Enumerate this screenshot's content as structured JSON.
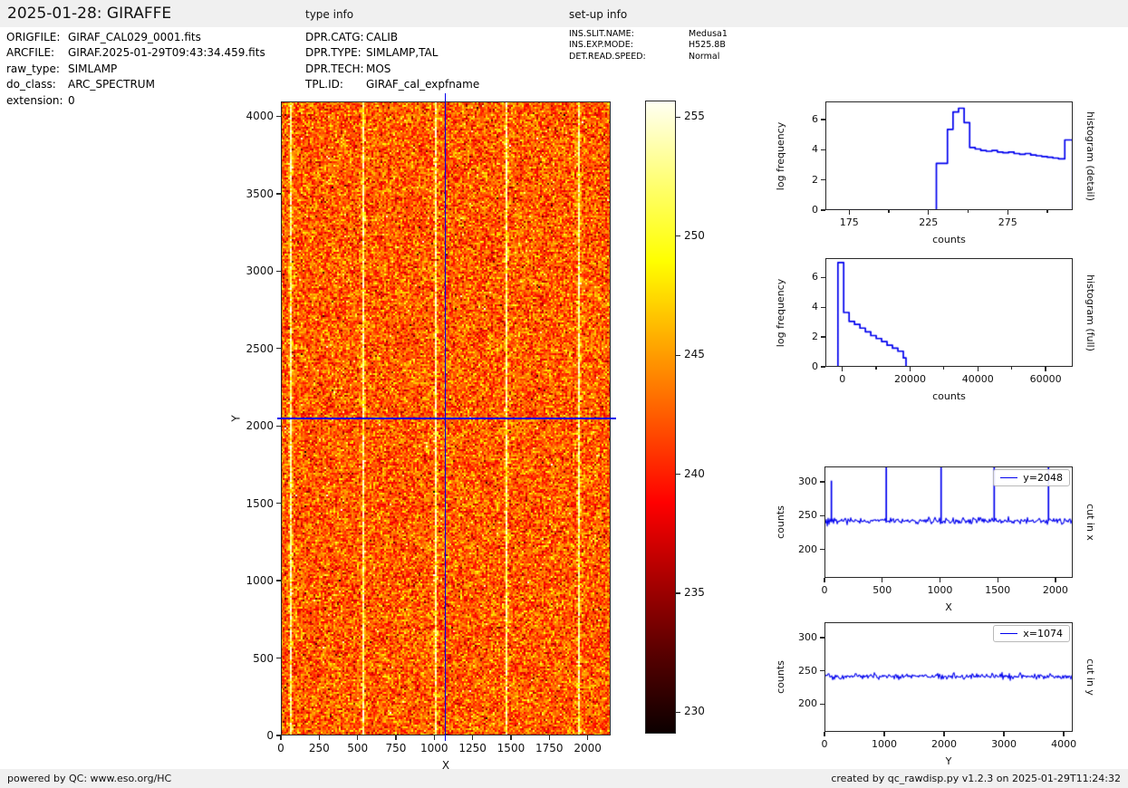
{
  "header": {
    "title": "2025-01-28: GIRAFFE",
    "type_info_heading": "type info",
    "setup_info_heading": "set-up info"
  },
  "file_info": {
    "rows": [
      {
        "label": "ORIGFILE:",
        "value": "GIRAF_CAL029_0001.fits"
      },
      {
        "label": "ARCFILE:",
        "value": "GIRAF.2025-01-29T09:43:34.459.fits"
      },
      {
        "label": "raw_type:",
        "value": "SIMLAMP"
      },
      {
        "label": "do_class:",
        "value": "ARC_SPECTRUM"
      },
      {
        "label": "extension:",
        "value": "0"
      }
    ]
  },
  "type_info": {
    "rows": [
      {
        "label": "DPR.CATG:",
        "value": "CALIB"
      },
      {
        "label": "DPR.TYPE:",
        "value": "SIMLAMP,TAL"
      },
      {
        "label": "DPR.TECH:",
        "value": "MOS"
      },
      {
        "label": "TPL.ID:",
        "value": "GIRAF_cal_expfname"
      }
    ]
  },
  "setup_info": {
    "rows": [
      {
        "label": "INS.SLIT.NAME:",
        "value": "Medusa1"
      },
      {
        "label": "INS.EXP.MODE:",
        "value": "H525.8B"
      },
      {
        "label": "DET.READ.SPEED:",
        "value": "Normal"
      }
    ]
  },
  "footer": {
    "left": "powered by QC: www.eso.org/HC",
    "right": "created by qc_rawdisp.py v1.2.3 on 2025-01-29T11:24:32"
  },
  "chart_data": [
    {
      "type": "heatmap",
      "name": "raw-frame-image",
      "xlabel": "X",
      "ylabel": "Y",
      "xlim": [
        0,
        2150
      ],
      "ylim": [
        0,
        4096
      ],
      "xticks": [
        0,
        250,
        500,
        750,
        1000,
        1250,
        1500,
        1750,
        2000
      ],
      "yticks": [
        0,
        500,
        1000,
        1500,
        2000,
        2500,
        3000,
        3500,
        4000
      ],
      "colormap": "hot",
      "vmin": 229.1,
      "vmax": 255.7,
      "background_mean": 242.5,
      "background_sigma": 3.0,
      "bright_lines_x": [
        60,
        535,
        1010,
        1470,
        1940
      ],
      "crosshair": {
        "x": 1074,
        "y": 2048,
        "color": "#0000ee"
      }
    },
    {
      "type": "colorbar",
      "name": "intensity-colorbar",
      "colormap": "hot",
      "range": [
        229.1,
        255.7
      ],
      "ticks": [
        230,
        235,
        240,
        245,
        250,
        255
      ]
    },
    {
      "type": "histogram",
      "name": "histogram-detail",
      "right_label": "histogram (detail)",
      "xlabel": "counts",
      "ylabel": "log frequency",
      "xlim": [
        160,
        316
      ],
      "ylim": [
        0,
        7.2
      ],
      "xticks": [
        175,
        225,
        275
      ],
      "xticks_minor": [
        200,
        250,
        300
      ],
      "yticks": [
        0,
        2,
        4,
        6
      ],
      "color": "#0000ee",
      "bin_edges": [
        160,
        230,
        237,
        240.5,
        244,
        247.5,
        251,
        254.5,
        258,
        261.5,
        265,
        268.5,
        272,
        275.5,
        279,
        282.5,
        286,
        289.5,
        293,
        296.5,
        300,
        303.5,
        307,
        311,
        316
      ],
      "values": [
        0,
        3.1,
        5.35,
        6.5,
        6.75,
        5.8,
        4.15,
        4.05,
        3.95,
        3.9,
        3.95,
        3.85,
        3.8,
        3.85,
        3.75,
        3.7,
        3.75,
        3.65,
        3.6,
        3.55,
        3.5,
        3.45,
        3.4,
        4.65
      ]
    },
    {
      "type": "histogram",
      "name": "histogram-full",
      "right_label": "histogram (full)",
      "xlabel": "counts",
      "ylabel": "log frequency",
      "xlim": [
        -5000,
        68000
      ],
      "ylim": [
        0,
        7.3
      ],
      "xticks": [
        0,
        20000,
        40000,
        60000
      ],
      "xticks_minor": [
        10000,
        30000,
        50000
      ],
      "yticks": [
        0,
        2,
        4,
        6
      ],
      "color": "#0000ee",
      "bin_edges": [
        -1300,
        400,
        2000,
        3600,
        5200,
        6800,
        8400,
        10000,
        11600,
        13200,
        14800,
        16400,
        18000,
        18800
      ],
      "values": [
        7.0,
        3.65,
        3.05,
        2.85,
        2.6,
        2.35,
        2.1,
        1.9,
        1.7,
        1.45,
        1.25,
        1.05,
        0.6
      ]
    },
    {
      "type": "line",
      "name": "cut-in-x",
      "legend": "y=2048",
      "right_label": "cut in x",
      "xlabel": "X",
      "ylabel": "counts",
      "xlim": [
        0,
        2150
      ],
      "ylim": [
        158,
        323
      ],
      "xticks": [
        0,
        500,
        1000,
        1500,
        2000
      ],
      "yticks": [
        200,
        250,
        300
      ],
      "color": "#0000ee",
      "baseline": 242.5,
      "noise_sigma": 2.4,
      "spikes": [
        {
          "x": 60,
          "value": 302
        },
        {
          "x": 535,
          "value": 340
        },
        {
          "x": 1010,
          "value": 340
        },
        {
          "x": 1470,
          "value": 340
        },
        {
          "x": 1940,
          "value": 340
        }
      ]
    },
    {
      "type": "line",
      "name": "cut-in-y",
      "legend": "x=1074",
      "right_label": "cut in y",
      "xlabel": "Y",
      "ylabel": "counts",
      "xlim": [
        0,
        4150
      ],
      "ylim": [
        158,
        323
      ],
      "xticks": [
        0,
        1000,
        2000,
        3000,
        4000
      ],
      "yticks": [
        200,
        250,
        300
      ],
      "color": "#0000ee",
      "baseline": 241.5,
      "noise_sigma": 2.2,
      "spikes": []
    }
  ]
}
